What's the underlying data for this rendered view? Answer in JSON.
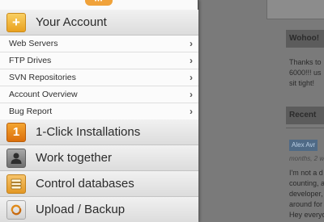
{
  "menu": {
    "handle_label": "•••",
    "account": {
      "title": "Your Account",
      "icon": "plus-icon"
    },
    "account_items": [
      {
        "label": "Web Servers"
      },
      {
        "label": "FTP Drives"
      },
      {
        "label": "SVN Repositories"
      },
      {
        "label": "Account Overview"
      },
      {
        "label": "Bug Report"
      }
    ],
    "sections": [
      {
        "label": "1-Click Installations",
        "icon": "one-click-icon",
        "icon_text": "1"
      },
      {
        "label": "Work together",
        "icon": "user-icon"
      },
      {
        "label": "Control databases",
        "icon": "database-icon"
      },
      {
        "label": "Upload / Backup",
        "icon": "sync-icon"
      }
    ]
  },
  "background": {
    "card1_title": "Wohoo!",
    "card1_text": [
      "Thanks to",
      "6000!!! us",
      "sit tight!"
    ],
    "card2_title": "Recent",
    "tag": "Alex Avr",
    "meta": "months, 2 w",
    "card2_text": [
      "I'm not a d",
      "counting, a",
      "developer,",
      "around for",
      "Hey everyo"
    ]
  },
  "colors": {
    "accent": "#f0a23a",
    "overlay": "#6e6e6e"
  }
}
